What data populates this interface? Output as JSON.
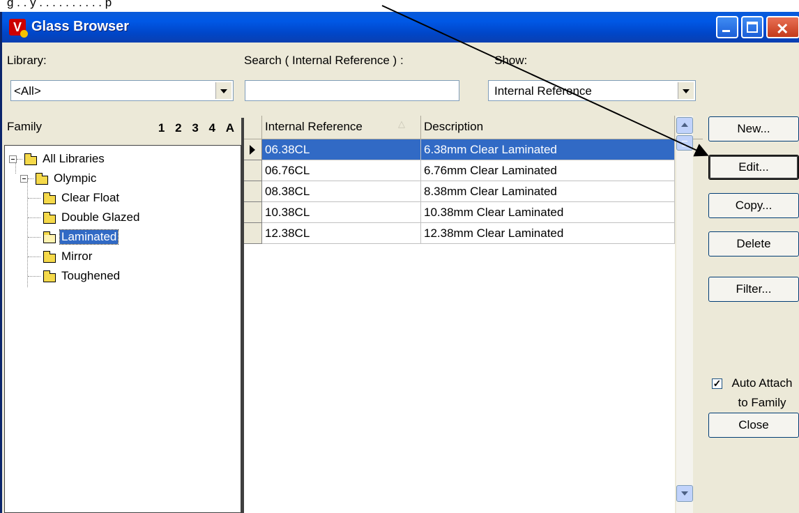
{
  "header_text": "g . . y . . . . . . . . . . p",
  "window": {
    "title": "Glass Browser",
    "icon_letter": "V"
  },
  "filters": {
    "library_label": "Library:",
    "library_value": "<All>",
    "search_label": "Search ( Internal Reference ) :",
    "search_value": "",
    "show_label": "Show:",
    "show_value": "Internal Reference"
  },
  "family": {
    "label": "Family",
    "levels": [
      "1",
      "2",
      "3",
      "4",
      "A"
    ],
    "tree": {
      "root": "All Libraries",
      "library": "Olympic",
      "items": [
        "Clear Float",
        "Double Glazed",
        "Laminated",
        "Mirror",
        "Toughened"
      ],
      "selected": "Laminated"
    }
  },
  "grid": {
    "columns": [
      "Internal Reference",
      "Description"
    ],
    "sorted_column": "Internal Reference",
    "rows": [
      {
        "ref": "06.38CL",
        "desc": "6.38mm Clear Laminated",
        "selected": true
      },
      {
        "ref": "06.76CL",
        "desc": "6.76mm Clear Laminated",
        "selected": false
      },
      {
        "ref": "08.38CL",
        "desc": "8.38mm Clear Laminated",
        "selected": false
      },
      {
        "ref": "10.38CL",
        "desc": "10.38mm Clear Laminated",
        "selected": false
      },
      {
        "ref": "12.38CL",
        "desc": "12.38mm Clear Laminated",
        "selected": false
      }
    ]
  },
  "buttons": {
    "new": "New...",
    "edit": "Edit...",
    "copy": "Copy...",
    "delete": "Delete",
    "filter": "Filter...",
    "close": "Close"
  },
  "auto_attach": {
    "checked": true,
    "label_line1": "Auto Attach",
    "label_line2": "to Family"
  },
  "colors": {
    "titlebar": "#0058e6",
    "selection": "#316ac5",
    "dialog": "#ece9d8"
  }
}
